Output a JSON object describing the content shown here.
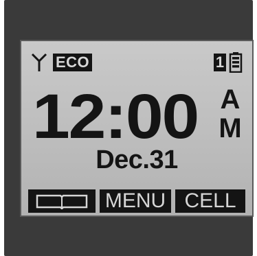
{
  "statusbar": {
    "signal_icon": "antenna-icon",
    "mode_badge": "ECO",
    "line_number": "1",
    "battery_icon": "battery-icon"
  },
  "clock": {
    "time": "12:00",
    "ampm_top": "A",
    "ampm_bottom": "M"
  },
  "date": {
    "text": "Dec.31"
  },
  "softkeys": {
    "left_icon": "book-icon",
    "center_label": "MENU",
    "right_label": "CELL"
  },
  "colors": {
    "lcd_background": "#c2c2c2",
    "lcd_ink": "#141414",
    "bezel": "#3a3a3a"
  }
}
